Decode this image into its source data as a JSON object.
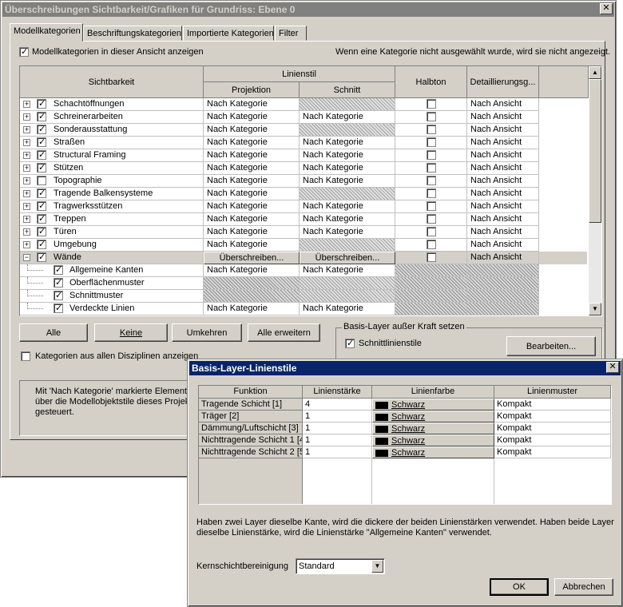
{
  "main_window": {
    "title": "Überschreibungen Sichtbarkeit/Grafiken für Grundriss: Ebene 0",
    "tabs": [
      "Modellkategorien",
      "Beschriftungskategorien",
      "Importierte Kategorien",
      "Filter"
    ],
    "show_categories_label": "Modellkategorien in dieser Ansicht anzeigen",
    "hint": "Wenn eine Kategorie nicht ausgewählt wurde, wird sie nicht angezeigt.",
    "headers": {
      "visibility": "Sichtbarkeit",
      "linestyle": "Linienstil",
      "projection": "Projektion",
      "cut": "Schnitt",
      "halftone": "Halbton",
      "detail": "Detaillierungsg..."
    },
    "rows": [
      {
        "name": "Schachtöffnungen",
        "proj": "Nach Kategorie",
        "cut": "",
        "detail": "Nach Ansicht"
      },
      {
        "name": "Schreinerarbeiten",
        "proj": "Nach Kategorie",
        "cut": "Nach Kategorie",
        "detail": "Nach Ansicht"
      },
      {
        "name": "Sonderausstattung",
        "proj": "Nach Kategorie",
        "cut": "",
        "detail": "Nach Ansicht"
      },
      {
        "name": "Straßen",
        "proj": "Nach Kategorie",
        "cut": "Nach Kategorie",
        "detail": "Nach Ansicht"
      },
      {
        "name": "Structural Framing",
        "proj": "Nach Kategorie",
        "cut": "Nach Kategorie",
        "detail": "Nach Ansicht"
      },
      {
        "name": "Stützen",
        "proj": "Nach Kategorie",
        "cut": "Nach Kategorie",
        "detail": "Nach Ansicht"
      },
      {
        "name": "Topographie",
        "proj": "Nach Kategorie",
        "cut": "Nach Kategorie",
        "detail": "Nach Ansicht"
      },
      {
        "name": "Tragende Balkensysteme",
        "proj": "Nach Kategorie",
        "cut": "",
        "detail": "Nach Ansicht"
      },
      {
        "name": "Tragwerksstützen",
        "proj": "Nach Kategorie",
        "cut": "Nach Kategorie",
        "detail": "Nach Ansicht"
      },
      {
        "name": "Treppen",
        "proj": "Nach Kategorie",
        "cut": "Nach Kategorie",
        "detail": "Nach Ansicht"
      },
      {
        "name": "Türen",
        "proj": "Nach Kategorie",
        "cut": "Nach Kategorie",
        "detail": "Nach Ansicht"
      },
      {
        "name": "Umgebung",
        "proj": "Nach Kategorie",
        "cut": "",
        "detail": "Nach Ansicht"
      },
      {
        "name": "Wände",
        "proj": "Überschreiben...",
        "cut": "Überschreiben...",
        "detail": "Nach Ansicht"
      },
      {
        "name": "Allgemeine Kanten",
        "proj": "Nach Kategorie",
        "cut": "Nach Kategorie",
        "detail": ""
      },
      {
        "name": "Oberflächenmuster",
        "proj": "",
        "cut": "",
        "detail": ""
      },
      {
        "name": "Schnittmuster",
        "proj": "",
        "cut": "",
        "detail": ""
      },
      {
        "name": "Verdeckte Linien",
        "proj": "Nach Kategorie",
        "cut": "Nach Kategorie",
        "detail": ""
      }
    ],
    "buttons": {
      "all": "Alle",
      "none": "Keine",
      "invert": "Umkehren",
      "expand_all": "Alle erweitern",
      "edit": "Bearbeiten..."
    },
    "override_group_label": "Basis-Layer außer Kraft setzen",
    "cut_linestyles_label": "Schnittlinienstile",
    "all_disciplines_label": "Kategorien aus allen Disziplinen anzeigen",
    "note_lines": [
      "Mit 'Nach Kategorie' markierte Elemente",
      "über die Modellobjektstile dieses Projekt",
      "gesteuert."
    ]
  },
  "sub_dialog": {
    "title": "Basis-Layer-Linienstile",
    "headers": [
      "Funktion",
      "Linienstärke",
      "Linienfarbe",
      "Linienmuster"
    ],
    "rows": [
      {
        "function": "Tragende Schicht [1]",
        "weight": "4",
        "color": "Schwarz",
        "pattern": "Kompakt"
      },
      {
        "function": "Träger [2]",
        "weight": "1",
        "color": "Schwarz",
        "pattern": "Kompakt"
      },
      {
        "function": "Dämmung/Luftschicht [3]",
        "weight": "1",
        "color": "Schwarz",
        "pattern": "Kompakt"
      },
      {
        "function": "Nichttragende Schicht 1 [4",
        "weight": "1",
        "color": "Schwarz",
        "pattern": "Kompakt"
      },
      {
        "function": "Nichttragende Schicht 2 [5",
        "weight": "1",
        "color": "Schwarz",
        "pattern": "Kompakt"
      }
    ],
    "info_line1": "Haben zwei Layer dieselbe Kante, wird die dickere der beiden Linienstärken verwendet. Haben beide Layer",
    "info_line2": "dieselbe Linienstärke, wird die Linienstärke \"Allgemeine Kanten\" verwendet.",
    "core_label": "Kernschichtbereinigung",
    "core_value": "Standard",
    "ok": "OK",
    "cancel": "Abbrechen"
  }
}
